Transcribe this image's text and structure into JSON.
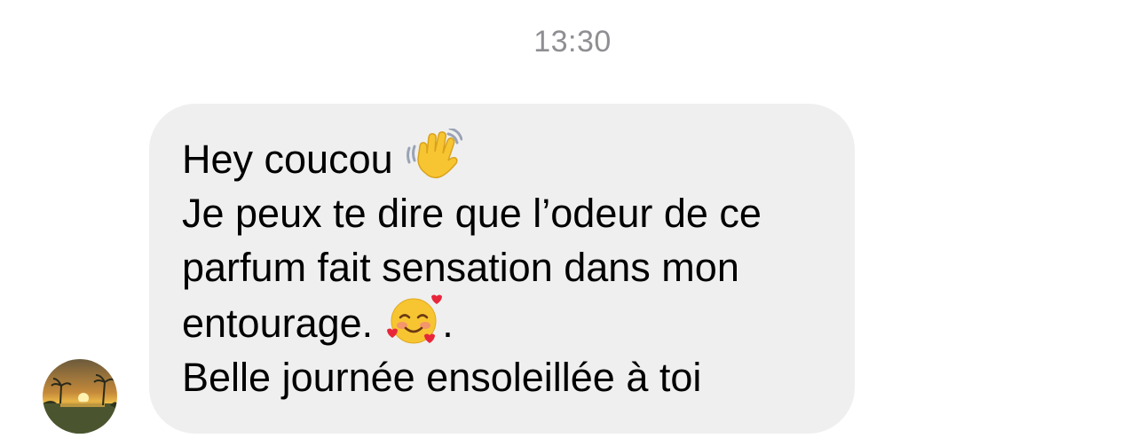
{
  "conversation": {
    "timestamp": "13:30"
  },
  "message": {
    "sender_avatar_icon": "sunset-photo-avatar",
    "lines": [
      "Hey coucou",
      "Je peux te dire que l’odeur de ce",
      "parfum fait sensation dans mon",
      "entourage.",
      "Belle journée ensoleillée à toi"
    ],
    "trailing_punctuation": ".",
    "emojis": [
      {
        "name": "waving-hand-icon",
        "after_line": 0
      },
      {
        "name": "smiling-face-with-hearts-icon",
        "after_line": 3
      }
    ]
  },
  "colors": {
    "background": "#ffffff",
    "bubble": "#efefef",
    "timestamp": "#8e8e93",
    "text": "#000000"
  }
}
